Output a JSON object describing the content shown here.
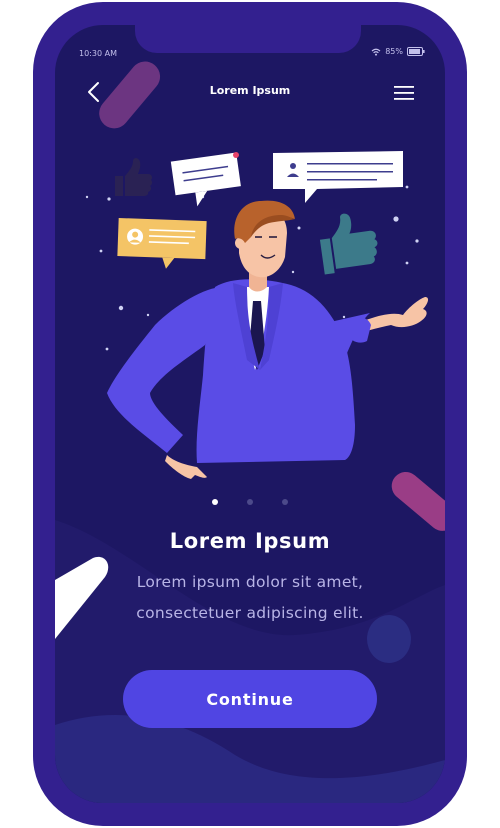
{
  "status": {
    "time": "10:30 AM",
    "battery": "85%"
  },
  "nav": {
    "title": "Lorem Ipsum",
    "back_icon": "chevron-left-icon",
    "menu_icon": "hamburger-menu-icon"
  },
  "pager": {
    "total": 3,
    "active_index": 0
  },
  "content": {
    "headline": "Lorem Ipsum",
    "body_line1": "Lorem ipsum dolor sit amet,",
    "body_line2": "consectetuer adipiscing elit."
  },
  "cta": {
    "label": "Continue"
  },
  "colors": {
    "frame": "#33208f",
    "screen": "#1d1763",
    "accent": "#5045e3",
    "suit": "#5a4ce6",
    "bubble_orange": "#f4c466"
  }
}
